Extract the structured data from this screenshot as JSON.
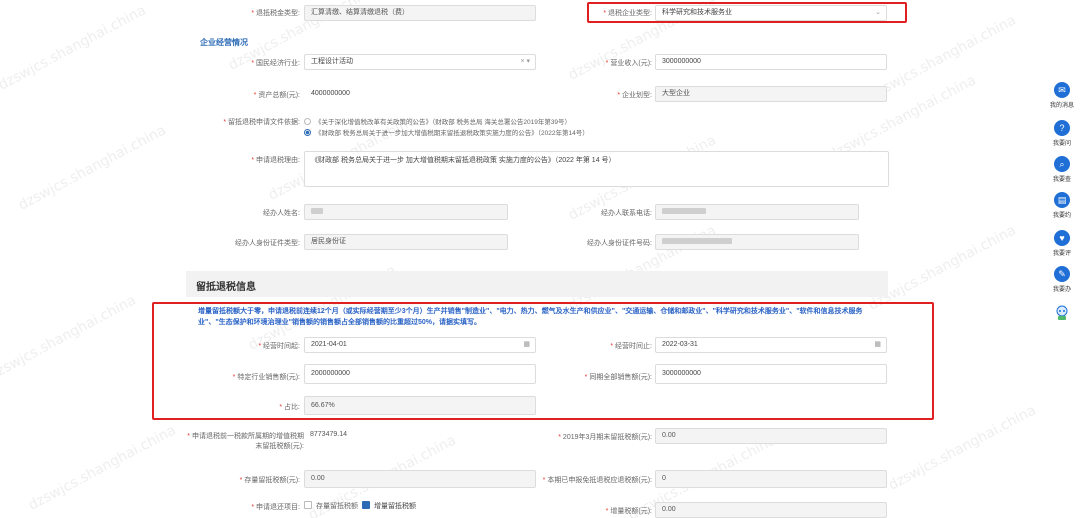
{
  "watermark": "dzswjcs.shanghai.china",
  "top": {
    "tax_type_label": "退抵税金类型:",
    "tax_type_value": "汇算清缴、结算清缴退税（费）",
    "enterprise_type_label": "退税企业类型:",
    "enterprise_type_value": "科学研究和技术服务业"
  },
  "ops": {
    "title": "企业经营情况",
    "industry_label": "国民经济行业:",
    "industry_value": "工程设计活动",
    "industry_clear": "×",
    "industry_arrow": "▾",
    "revenue_label": "营业收入(元):",
    "revenue_value": "3000000000",
    "assets_label": "资产总额(元):",
    "assets_value": "4000000000",
    "scale_label": "企业划型:",
    "scale_value": "大型企业",
    "basis_label": "留抵退税申请文件依据:",
    "basis_option1": "《关于深化增值税改革有关政策的公告》（财政部 税务总局 海关总署公告2019年第39号）",
    "basis_option2": "《财政部 税务总局关于进一步加大增值税期末留抵退税政策实施力度的公告》（2022年第14号）",
    "reason_label": "申请退税理由:",
    "reason_value": "《财政部 税务总局关于进一步 加大增值税期末留抵退税政策 实施力度的公告》（2022 年第 14 号）",
    "handler_name_label": "经办人姓名:",
    "handler_phone_label": "经办人联系电话:",
    "id_type_label": "经办人身份证件类型:",
    "id_type_value": "居民身份证",
    "id_no_label": "经办人身份证件号码:"
  },
  "refund": {
    "title": "留抵退税信息",
    "notice": "增量留抵税额大于零，申请退税前连续12个月（或实际经营期至少3个月）生产并销售\"制造业\"、\"电力、热力、燃气及水生产和供应业\"、\"交通运输、仓储和邮政业\"、\"科学研究和技术服务业\"、\"软件和信息技术服务业\"、\"生态保护和环境治理业\"销售额的销售额占全部销售额的比重超过50%，请据实填写。",
    "start_label": "经营时间起:",
    "start_value": "2021-04-01",
    "end_label": "经营时间止:",
    "end_value": "2022-03-31",
    "specific_sales_label": "特定行业销售额(元):",
    "specific_sales_value": "2000000000",
    "total_sales_label": "同期全部销售额(元):",
    "total_sales_value": "3000000000",
    "ratio_label": "占比:",
    "ratio_value": "66.67%",
    "prev_credit_label": "申请退税前一税款所属期的增值税期末留抵税额(元):",
    "prev_credit_value": "8773479.14",
    "credit_2019_label": "2019年3月期末留抵税额(元):",
    "credit_2019_value": "0.00",
    "stock_credit_label": "存量留抵税额(元):",
    "stock_credit_value": "0.00",
    "deducted_label": "本期已申报免抵退税应退税额(元):",
    "deducted_value": "0",
    "items_label": "申请退还项目:",
    "item_stock": "存量留抵税额",
    "item_incr": "增量留抵税额",
    "incr_label": "增量税额(元):",
    "incr_value": "0.00"
  },
  "rail": [
    {
      "icon": "✉",
      "label": "我的消息"
    },
    {
      "icon": "?",
      "label": "我要问"
    },
    {
      "icon": "⌕",
      "label": "我要查"
    },
    {
      "icon": "▤",
      "label": "我要约"
    },
    {
      "icon": "♥",
      "label": "我要评"
    },
    {
      "icon": "✎",
      "label": "我要办"
    }
  ],
  "colors": {
    "accent": "#2d6cb5",
    "highlight": "#e02020",
    "rail": "#1f6fd6"
  }
}
